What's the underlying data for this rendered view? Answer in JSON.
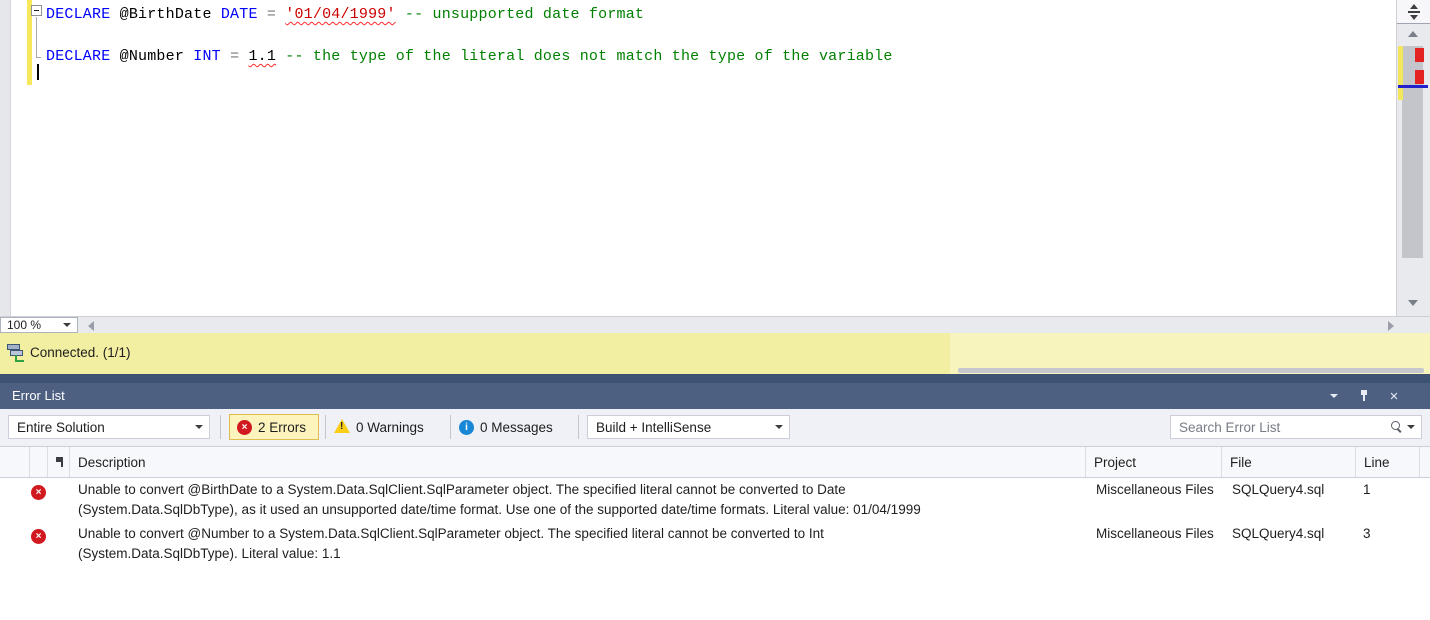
{
  "editor": {
    "zoom_level": "100 %",
    "lines": [
      {
        "tokens": [
          {
            "t": "DECLARE ",
            "c": "kw"
          },
          {
            "t": "@BirthDate ",
            "c": "plain"
          },
          {
            "t": "DATE ",
            "c": "kw"
          },
          {
            "t": "= ",
            "c": "op"
          },
          {
            "t": "'01/04/1999'",
            "c": "str",
            "squiggle": true
          },
          {
            "t": " ",
            "c": "plain"
          },
          {
            "t": "-- unsupported date format",
            "c": "com"
          }
        ]
      },
      {
        "tokens": []
      },
      {
        "tokens": [
          {
            "t": "DECLARE ",
            "c": "kw"
          },
          {
            "t": "@Number ",
            "c": "plain"
          },
          {
            "t": "INT ",
            "c": "kw"
          },
          {
            "t": "= ",
            "c": "op"
          },
          {
            "t": "1.1",
            "c": "num",
            "squiggle": true
          },
          {
            "t": " ",
            "c": "plain"
          },
          {
            "t": "-- the type of the literal does not match the type of the variable",
            "c": "com"
          }
        ]
      },
      {
        "tokens": []
      }
    ]
  },
  "status_bar": {
    "label": "Connected. (1/1)"
  },
  "error_list": {
    "title": "Error List",
    "toolbar": {
      "scope_filter": "Entire Solution",
      "errors_label": "2 Errors",
      "warnings_label": "0 Warnings",
      "messages_label": "0 Messages",
      "source_filter": "Build + IntelliSense",
      "search_placeholder": "Search Error List"
    },
    "columns": [
      "Description",
      "Project",
      "File",
      "Line"
    ],
    "rows": [
      {
        "description_lines": [
          "Unable to convert @BirthDate to a System.Data.SqlClient.SqlParameter object. The specified literal cannot be converted to Date",
          "(System.Data.SqlDbType), as it used an unsupported date/time format. Use one of the supported date/time formats. Literal value: 01/04/1999"
        ],
        "project": "Miscellaneous Files",
        "file": "SQLQuery4.sql",
        "line": "1"
      },
      {
        "description_lines": [
          "Unable to convert @Number to a System.Data.SqlClient.SqlParameter object. The specified literal cannot be converted to Int",
          "(System.Data.SqlDbType). Literal value: 1.1"
        ],
        "project": "Miscellaneous Files",
        "file": "SQLQuery4.sql",
        "line": "3"
      }
    ]
  },
  "icons": {
    "status": "database-connected-icon",
    "errors": "red-circle-x-icon",
    "warnings": "yellow-triangle-icon",
    "messages": "blue-info-icon",
    "search": "magnifier-icon"
  },
  "colors": {
    "error_red": "#d11a1f",
    "warning_yellow": "#fbce18",
    "info_blue": "#1a87d6",
    "status_bar_yellow": "#f2eea2",
    "title_bar_blue": "#4d6082",
    "change_bar_yellow": "#f7e75a",
    "keyword_blue": "#0000ff",
    "string_red": "#cc0000",
    "comment_green": "#008000"
  }
}
